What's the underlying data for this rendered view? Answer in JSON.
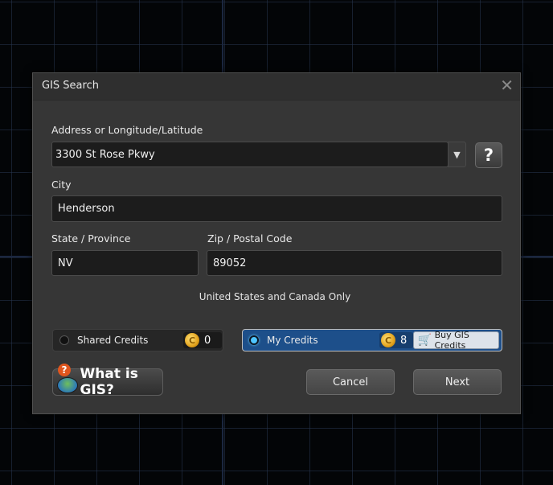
{
  "dialog": {
    "title": "GIS Search",
    "close_glyph": "✕"
  },
  "address": {
    "label": "Address or Longitude/Latitude",
    "value": "3300 St Rose Pkwy",
    "dropdown_glyph": "▼",
    "help_glyph": "?"
  },
  "city": {
    "label": "City",
    "value": "Henderson"
  },
  "state": {
    "label": "State / Province",
    "value": "NV"
  },
  "zip": {
    "label": "Zip / Postal Code",
    "value": "89052"
  },
  "region_note": "United States and Canada Only",
  "credits": {
    "shared": {
      "label": "Shared Credits",
      "count": "0",
      "selected": false
    },
    "mine": {
      "label": "My Credits",
      "count": "8",
      "selected": true
    },
    "buy_label": "Buy GIS Credits"
  },
  "buttons": {
    "what_is_gis": "What is GIS?",
    "cancel": "Cancel",
    "next": "Next"
  },
  "icons": {
    "close": "close-icon",
    "dropdown": "chevron-down-icon",
    "help": "question-mark-icon",
    "coin": "credit-coin-icon",
    "cart": "shopping-cart-icon",
    "gis": "gis-map-icon"
  },
  "colors": {
    "dialog_bg": "#363636",
    "field_bg": "#1c1c1c",
    "selected_credit_bg": "#1d4f8a",
    "radio_on": "#4fc6ff",
    "coin": "#e2a21c"
  }
}
